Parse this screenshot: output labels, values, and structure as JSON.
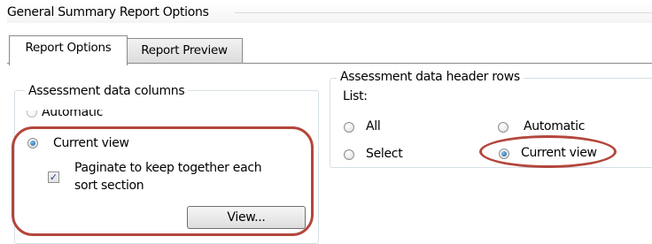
{
  "window": {
    "title": "General Summary Report Options"
  },
  "tabs": [
    {
      "label": "Report Options",
      "active": true
    },
    {
      "label": "Report Preview",
      "active": false
    }
  ],
  "columns_group": {
    "legend": "Assessment data columns",
    "automatic_label": "Automatic",
    "current_view_label": "Current view",
    "selected": "Current view",
    "paginate_label_line1": "Paginate to keep together each",
    "paginate_label_line2": "sort section",
    "paginate_checked": true,
    "view_button_label": "View..."
  },
  "header_rows_group": {
    "legend": "Assessment data header rows",
    "list_label": "List:",
    "options": [
      "All",
      "Select",
      "Automatic",
      "Current view"
    ],
    "all_label": "All",
    "select_label": "Select",
    "automatic_label": "Automatic",
    "current_view_label": "Current view",
    "selected": "Current view"
  },
  "colors": {
    "highlight": "#b4463c",
    "radio_fill": "#1c5e9e",
    "groupbox_border": "#d5dfe5"
  },
  "icons": {
    "checkbox_mark": "✓"
  }
}
